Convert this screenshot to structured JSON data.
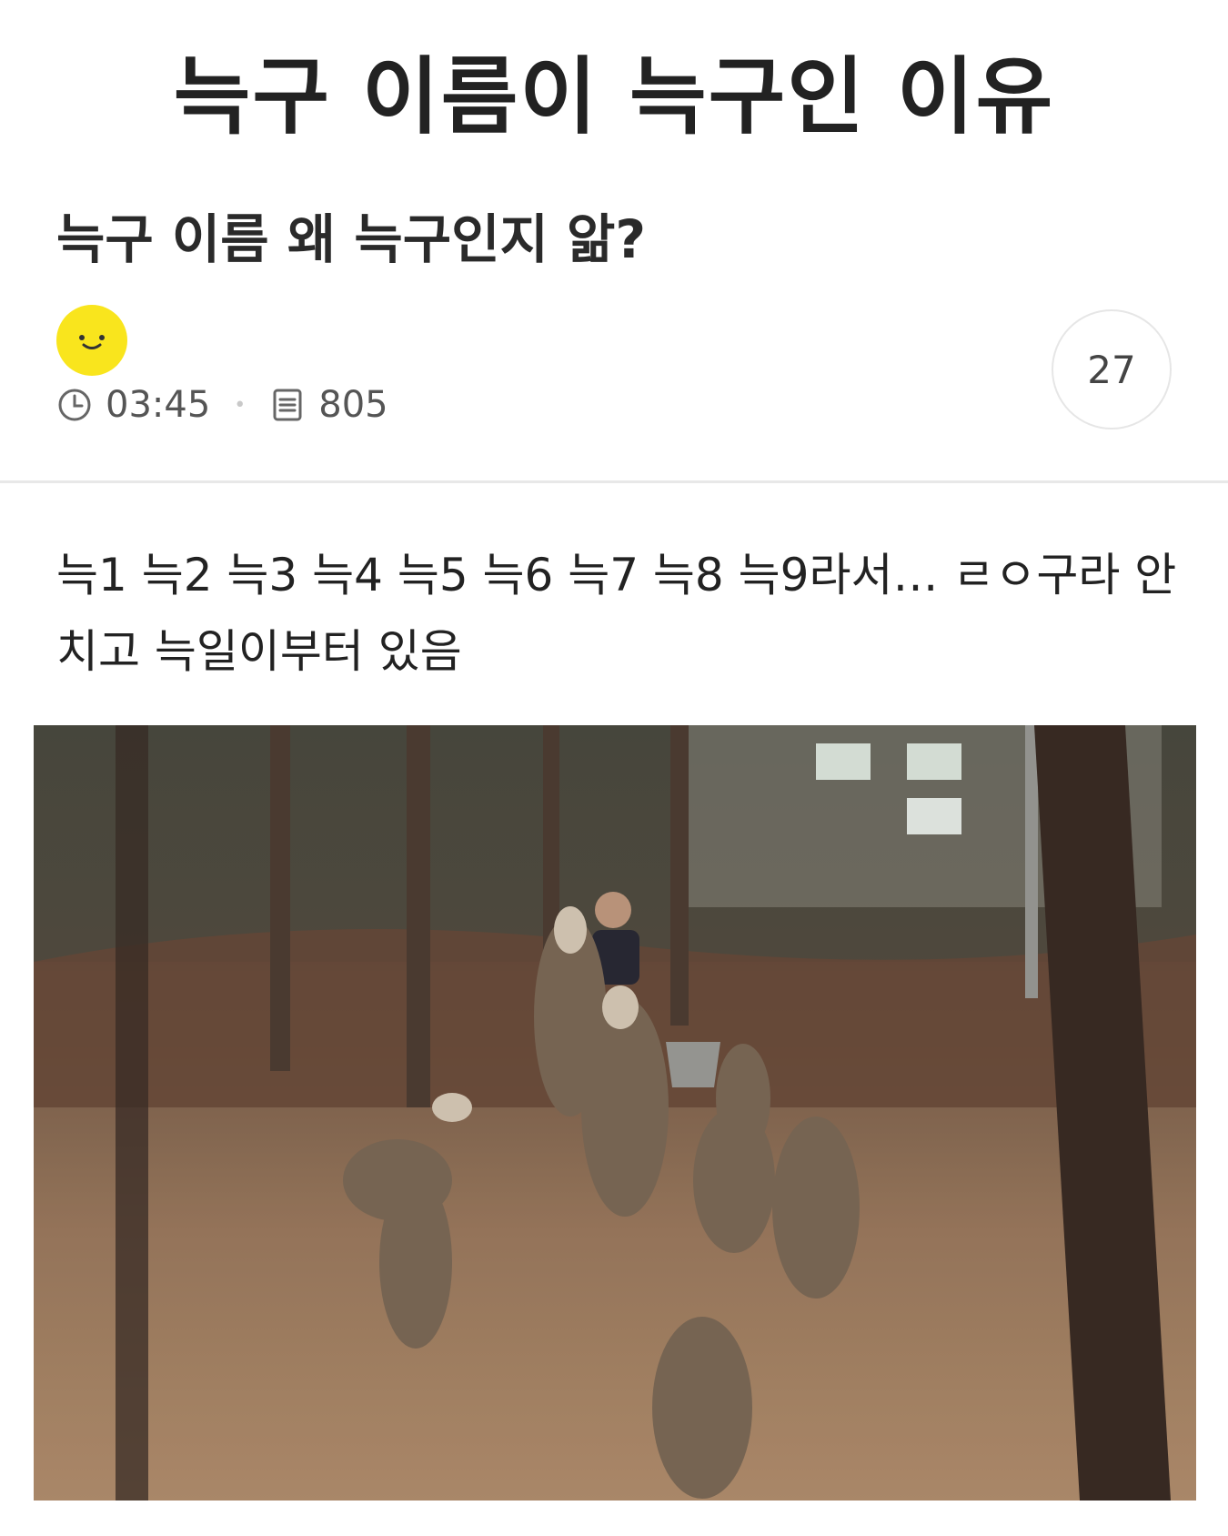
{
  "post": {
    "title": "늑구 이름이 늑구인 이유",
    "subtitle": "늑구 이름 왜 늑구인지 앎?",
    "time": "03:45",
    "views": "805",
    "comment_count": "27",
    "body_lines": [
      "늑1 늑2 늑3 늑4 늑5 늑6 늑7 늑8 늑9라서… ㄹㅇ구라 안",
      "치고 늑일이부터 있음"
    ]
  },
  "icons": {
    "avatar": "smiley-face-icon",
    "time": "clock-icon",
    "views": "document-list-icon"
  },
  "colors": {
    "avatar_bg": "#f9e51d",
    "text_primary": "#222222",
    "text_meta": "#555555",
    "divider": "#e8e8e8"
  },
  "image": {
    "description_free": true
  }
}
